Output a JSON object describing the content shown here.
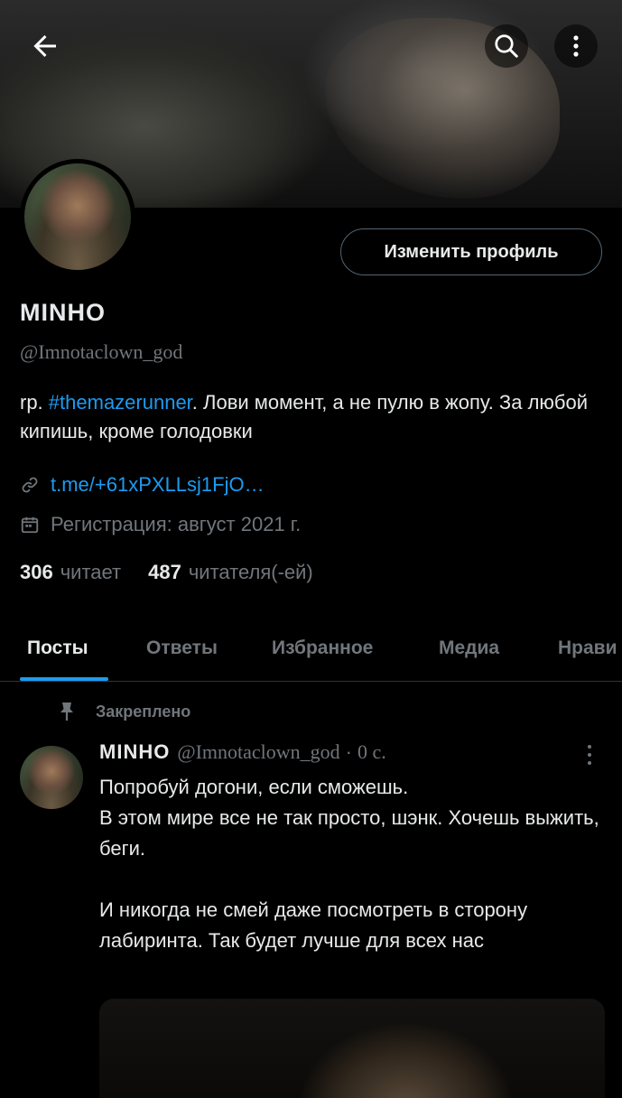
{
  "header": {
    "back_icon": "arrow-left-icon",
    "search_icon": "search-icon",
    "more_icon": "more-vertical-icon"
  },
  "profile": {
    "edit_button_label": "Изменить профиль",
    "name": "MINHO",
    "handle": "@Imnotaclown_god",
    "bio_prefix": "rp. ",
    "bio_hashtag": "#themazerunner",
    "bio_rest": ". Лови момент, а не пулю в жопу. За любой кипишь, кроме голодовки",
    "link_text": "t.me/+61xPXLLsj1FjO…",
    "joined_text": "Регистрация: август 2021 г.",
    "following_count": "306",
    "following_label": "читает",
    "followers_count": "487",
    "followers_label": "читателя(-ей)"
  },
  "tabs": [
    {
      "label": "Посты",
      "active": true
    },
    {
      "label": "Ответы",
      "active": false
    },
    {
      "label": "Избранное",
      "active": false
    },
    {
      "label": "Медиа",
      "active": false
    },
    {
      "label": "Нрави",
      "active": false
    }
  ],
  "pinned_post": {
    "pinned_label": "Закреплено",
    "author_name": "MINHO",
    "author_handle": "@Imnotaclown_god",
    "separator": "·",
    "time": "0 с.",
    "text_lines": [
      "Попробуй догони, если сможешь.",
      "В этом мире все не так просто, шэнк. Хочешь выжить, беги.",
      "",
      "И никогда не смей даже посмотреть в сторону лабиринта. Так будет лучше для всех нас"
    ]
  },
  "colors": {
    "background": "#000000",
    "text": "#e7e9ea",
    "muted": "#71767b",
    "accent": "#1d9bf0",
    "border": "#2f3336"
  }
}
